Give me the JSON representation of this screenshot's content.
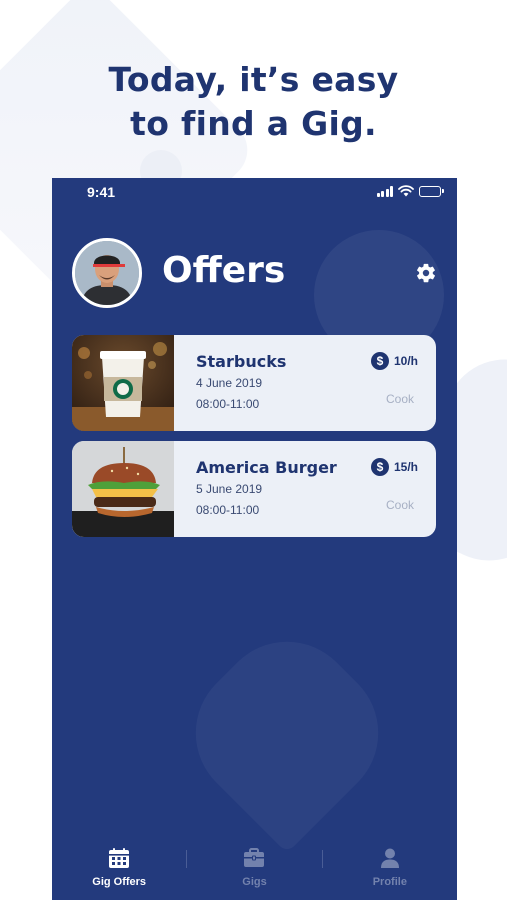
{
  "headline": {
    "line1": "Today, it’s easy",
    "line2": "to find a Gig."
  },
  "status_bar": {
    "time": "9:41",
    "icons": [
      "signal-icon",
      "wifi-icon",
      "battery-icon"
    ]
  },
  "header": {
    "title": "Offers",
    "settings_icon": "gear-icon",
    "avatar": "user-avatar"
  },
  "offers": [
    {
      "name": "Starbucks",
      "date": "4 June 2019",
      "time": "08:00-11:00",
      "rate": "10/h",
      "role": "Cook",
      "image": "coffee-cup-photo"
    },
    {
      "name": "America Burger",
      "date": "5 June 2019",
      "time": "08:00-11:00",
      "rate": "15/h",
      "role": "Cook",
      "image": "burger-photo"
    }
  ],
  "rate_symbol": "$",
  "tabs": [
    {
      "label": "Gig Offers",
      "icon": "calendar-icon",
      "active": true
    },
    {
      "label": "Gigs",
      "icon": "briefcase-icon",
      "active": false
    },
    {
      "label": "Profile",
      "icon": "person-icon",
      "active": false
    }
  ],
  "colors": {
    "primary": "#233a7d",
    "headline": "#1f3470",
    "card": "#ecf0f7",
    "inactive_tab": "#7382ad"
  }
}
